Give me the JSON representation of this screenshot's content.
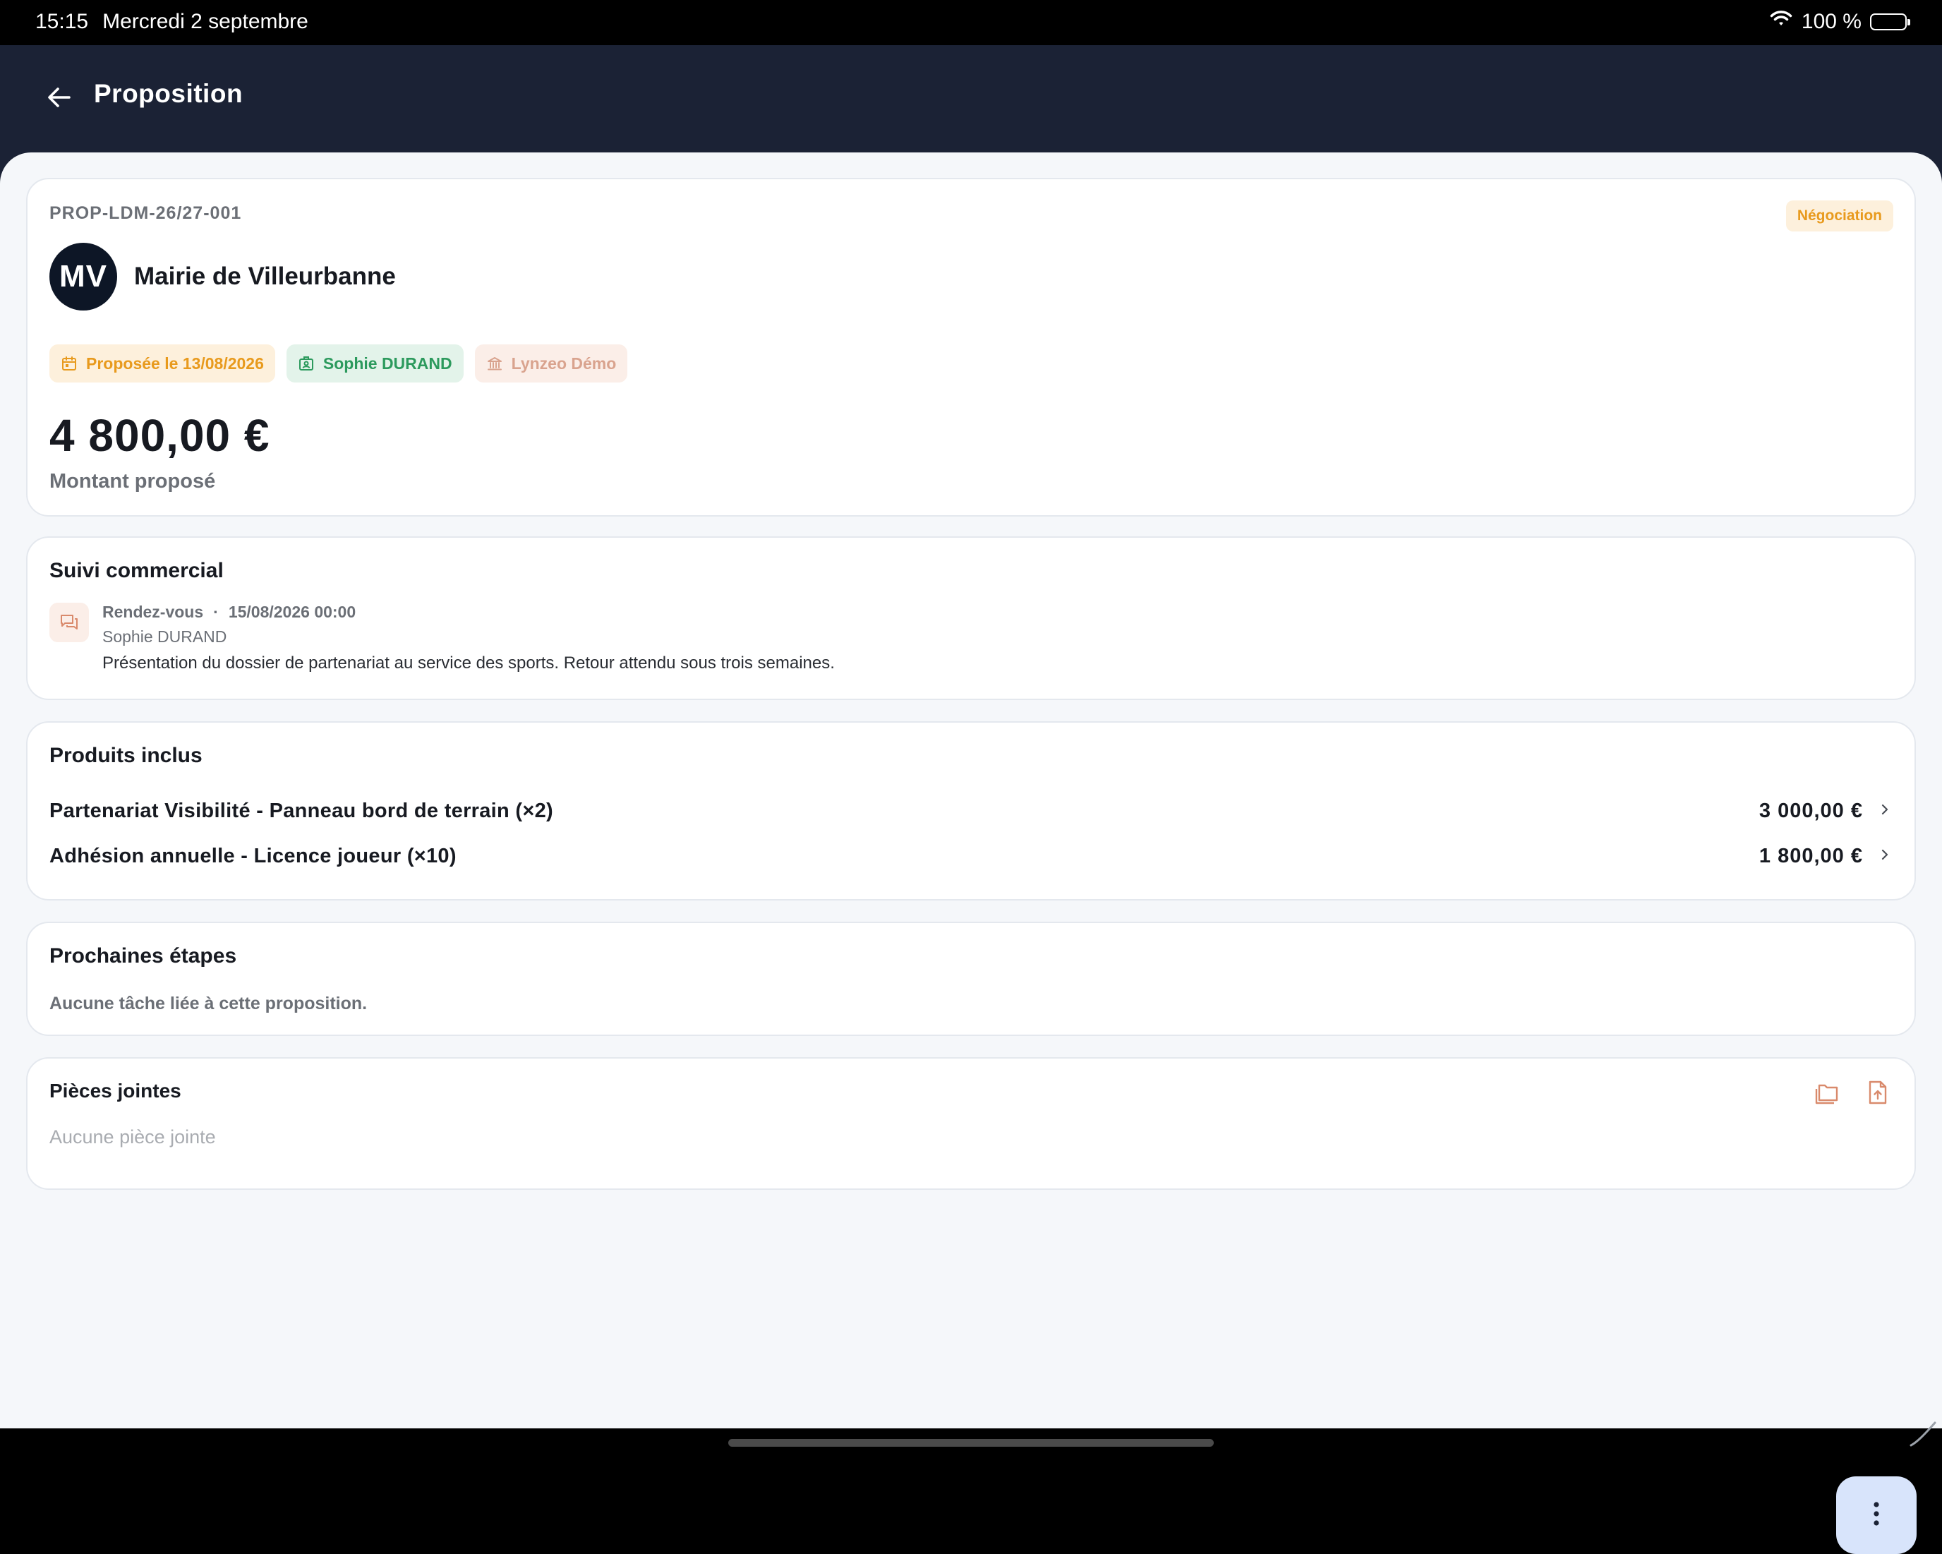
{
  "status_bar": {
    "time": "15:15",
    "date": "Mercredi 2 septembre",
    "battery": "100 %"
  },
  "app_bar": {
    "title": "Proposition"
  },
  "proposal": {
    "reference": "PROP-LDM-26/27-001",
    "status": "Négociation",
    "client_initials": "MV",
    "client_name": "Mairie de Villeurbanne",
    "chips": {
      "date": "Proposée le 13/08/2026",
      "owner": "Sophie DURAND",
      "organization": "Lynzeo Démo"
    },
    "amount": "4 800,00 €",
    "amount_label": "Montant proposé"
  },
  "suivi": {
    "title": "Suivi commercial",
    "entries": [
      {
        "type": "Rendez-vous",
        "separator": "·",
        "datetime": "15/08/2026 00:00",
        "author": "Sophie DURAND",
        "text": "Présentation du dossier de partenariat au service des sports. Retour attendu sous trois semaines."
      }
    ]
  },
  "produits": {
    "title": "Produits inclus",
    "items": [
      {
        "name": "Partenariat Visibilité - Panneau bord de terrain (×2)",
        "price": "3 000,00 €"
      },
      {
        "name": "Adhésion annuelle - Licence joueur (×10)",
        "price": "1 800,00 €"
      }
    ]
  },
  "etapes": {
    "title": "Prochaines étapes",
    "empty": "Aucune tâche liée à cette proposition."
  },
  "pieces": {
    "title": "Pièces jointes",
    "empty": "Aucune pièce jointe"
  },
  "colors": {
    "app_bar": "#1b2235",
    "background": "#f5f7fa",
    "accent_orange": "#e89a1d",
    "accent_green": "#2c9a5d",
    "accent_peach": "#d9a38e",
    "fab": "#d8e4fb"
  },
  "icons": {
    "back": "arrow-left-icon",
    "wifi": "wifi-icon",
    "battery": "battery-icon",
    "calendar": "calendar-icon",
    "owner": "id-badge-icon",
    "organization": "bank-icon",
    "timeline": "chat-icon",
    "chevron": "chevron-right-icon",
    "folder": "folder-icon",
    "upload": "file-upload-icon",
    "more": "more-vertical-icon"
  }
}
